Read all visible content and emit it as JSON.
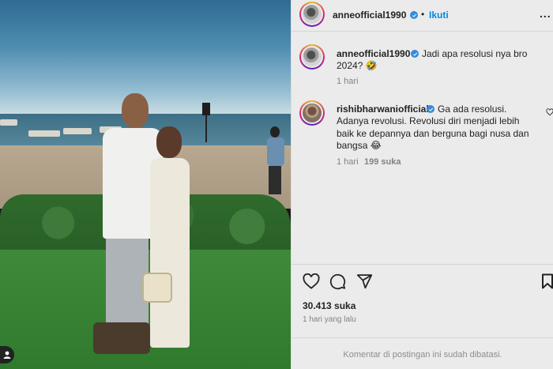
{
  "post": {
    "author": "anneofficial1990",
    "separator": "•",
    "follow_label": "Ikuti",
    "more_label": "...",
    "likes": "30.413 suka",
    "time": "1 hari yang lalu",
    "comments_disabled": "Komentar di postingan ini sudah dibatasi."
  },
  "comments": [
    {
      "username": "anneofficial1990",
      "line1": "Jadi apa resolusi nya bro",
      "line2": "2024? 🤣",
      "time": "1 hari"
    },
    {
      "username": "rishibharwaniofficial",
      "line1": "Ga ada resolusi.",
      "line2": "Adanya revolusi. Revolusi diri menjadi lebih",
      "line3": "baik ke depannya dan berguna bagi nusa dan",
      "line4": "bangsa 😂",
      "time": "1 hari",
      "likes": "199 suka"
    }
  ],
  "icons": {
    "like": "heart-icon",
    "comment": "comment-icon",
    "share": "share-icon",
    "save": "bookmark-icon",
    "verified": "verified-badge-icon",
    "tagged": "person-icon"
  },
  "colors": {
    "accent": "#0095f6",
    "verified": "#3897f0",
    "muted": "#8e8e8e",
    "text": "#262626"
  }
}
